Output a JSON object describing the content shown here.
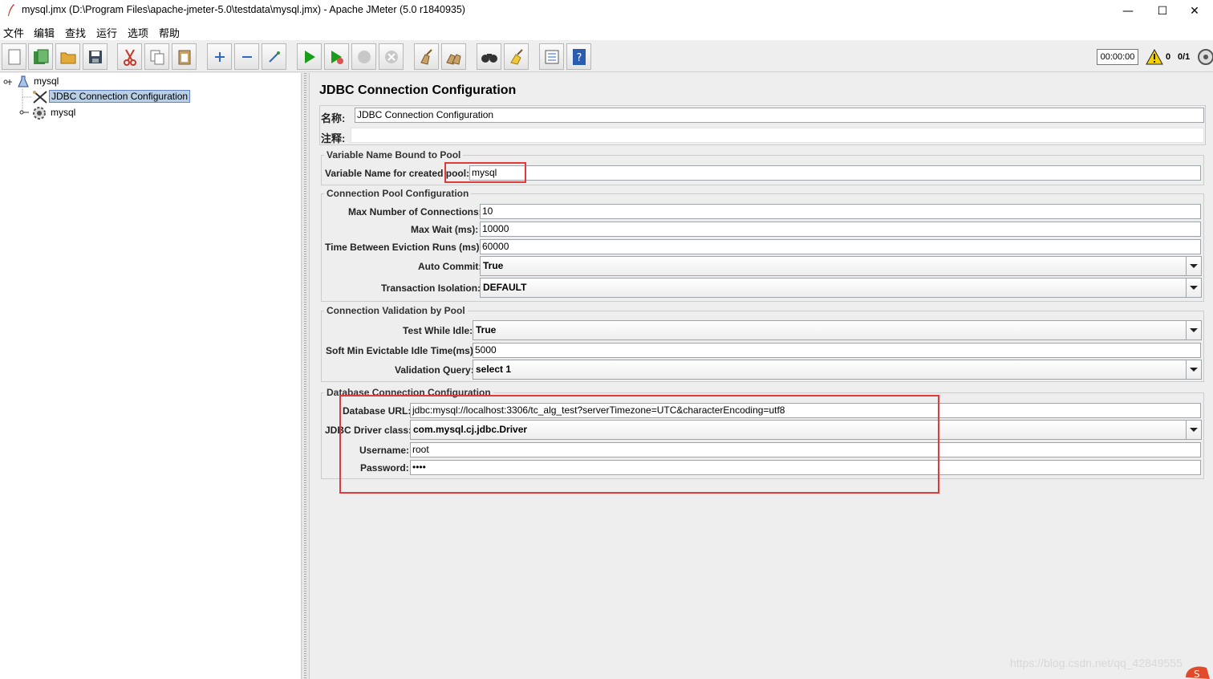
{
  "window": {
    "title": "mysql.jmx (D:\\Program Files\\apache-jmeter-5.0\\testdata\\mysql.jmx) - Apache JMeter (5.0 r1840935)",
    "minimize": "—",
    "maximize": "☐",
    "close": "✕"
  },
  "menu": [
    "文件",
    "编辑",
    "查找",
    "运行",
    "选项",
    "帮助"
  ],
  "toolbar": {
    "timer": "00:00:00",
    "warning_count": "0",
    "thread_count": "0/1"
  },
  "tree": {
    "root": "mysql",
    "selected": "JDBC Connection Configuration",
    "child": "mysql"
  },
  "panel": {
    "heading": "JDBC Connection Configuration",
    "name_label": "名称:",
    "name_value": "JDBC Connection Configuration",
    "comment_label": "注释:",
    "comment_value": ""
  },
  "var_section": {
    "legend": "Variable Name Bound to Pool",
    "label": "Variable Name for created pool:",
    "value": "mysql"
  },
  "pool_section": {
    "legend": "Connection Pool Configuration",
    "max_conn_label": "Max Number of Connections:",
    "max_conn_value": "10",
    "max_wait_label": "Max Wait (ms):",
    "max_wait_value": "10000",
    "eviction_label": "Time Between Eviction Runs (ms):",
    "eviction_value": "60000",
    "auto_commit_label": "Auto Commit:",
    "auto_commit_value": "True",
    "isolation_label": "Transaction Isolation:",
    "isolation_value": "DEFAULT"
  },
  "validation_section": {
    "legend": "Connection Validation by Pool",
    "test_idle_label": "Test While Idle:",
    "test_idle_value": "True",
    "soft_min_label": "Soft Min Evictable Idle Time(ms):",
    "soft_min_value": "5000",
    "query_label": "Validation Query:",
    "query_value": "select 1"
  },
  "db_section": {
    "legend": "Database Connection Configuration",
    "url_label": "Database URL:",
    "url_value": "jdbc:mysql://localhost:3306/tc_alg_test?serverTimezone=UTC&characterEncoding=utf8",
    "driver_label": "JDBC Driver class:",
    "driver_value": "com.mysql.cj.jdbc.Driver",
    "username_label": "Username:",
    "username_value": "root",
    "password_label": "Password:",
    "password_value": "••••"
  },
  "watermark": "https://blog.csdn.net/qq_42849555",
  "colors": {
    "highlight_red": "#e03a3a",
    "selection_blue": "#b8cfe5",
    "run_green": "#1a9e1a"
  }
}
